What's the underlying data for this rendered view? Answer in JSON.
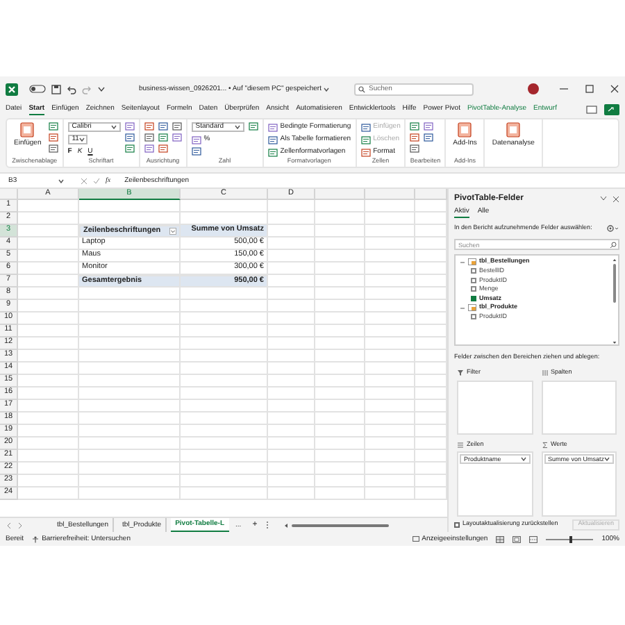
{
  "title_bar": {
    "title": "business-wissen_0926201... • Auf \"diesem PC\" gespeichert",
    "search": {
      "placeholder": "Suchen"
    }
  },
  "menu_tabs": [
    {
      "label": "Datei",
      "selected": false,
      "contextual": false
    },
    {
      "label": "Start",
      "selected": true,
      "contextual": false
    },
    {
      "label": "Einfügen",
      "selected": false,
      "contextual": false
    },
    {
      "label": "Zeichnen",
      "selected": false,
      "contextual": false
    },
    {
      "label": "Seitenlayout",
      "selected": false,
      "contextual": false
    },
    {
      "label": "Formeln",
      "selected": false,
      "contextual": false
    },
    {
      "label": "Daten",
      "selected": false,
      "contextual": false
    },
    {
      "label": "Überprüfen",
      "selected": false,
      "contextual": false
    },
    {
      "label": "Ansicht",
      "selected": false,
      "contextual": false
    },
    {
      "label": "Automatisieren",
      "selected": false,
      "contextual": false
    },
    {
      "label": "Entwicklertools",
      "selected": false,
      "contextual": false
    },
    {
      "label": "Hilfe",
      "selected": false,
      "contextual": false
    },
    {
      "label": "Power Pivot",
      "selected": false,
      "contextual": false
    },
    {
      "label": "PivotTable-Analyse",
      "selected": false,
      "contextual": true
    },
    {
      "label": "Entwurf",
      "selected": false,
      "contextual": true
    }
  ],
  "ribbon": [
    {
      "label": "Zwischenablage",
      "items": [
        {
          "kind": "large",
          "label": "Einfügen"
        },
        {
          "kind": "icon"
        },
        {
          "kind": "icon"
        },
        {
          "kind": "icon"
        }
      ]
    },
    {
      "label": "Schriftart",
      "items": [
        {
          "kind": "dropdown",
          "value": "Calibri",
          "wide": true
        },
        {
          "kind": "dropdown",
          "value": "11",
          "wide": false
        },
        {
          "kind": "letters",
          "labels": [
            "F",
            "K",
            "U"
          ]
        },
        {
          "kind": "icon"
        },
        {
          "kind": "icon"
        },
        {
          "kind": "icon"
        }
      ]
    },
    {
      "label": "Ausrichtung",
      "items": [
        {
          "kind": "icon"
        },
        {
          "kind": "icon"
        },
        {
          "kind": "icon"
        },
        {
          "kind": "icon"
        },
        {
          "kind": "icon"
        },
        {
          "kind": "icon"
        },
        {
          "kind": "icon"
        },
        {
          "kind": "icon"
        }
      ]
    },
    {
      "label": "Zahl",
      "items": [
        {
          "kind": "dropdown",
          "value": "Standard",
          "wide": true
        },
        {
          "kind": "small",
          "label": "%",
          "disabled": false
        },
        {
          "kind": "icon"
        },
        {
          "kind": "icon"
        }
      ]
    },
    {
      "label": "Formatvorlagen",
      "items": [
        {
          "kind": "small",
          "label": "Bedingte Formatierung",
          "disabled": false
        },
        {
          "kind": "small",
          "label": "Als Tabelle formatieren",
          "disabled": false
        },
        {
          "kind": "small",
          "label": "Zellenformatvorlagen",
          "disabled": false
        }
      ]
    },
    {
      "label": "Zellen",
      "items": [
        {
          "kind": "small",
          "label": "Einfügen",
          "disabled": true
        },
        {
          "kind": "small",
          "label": "Löschen",
          "disabled": true
        },
        {
          "kind": "small",
          "label": "Format",
          "disabled": false
        }
      ]
    },
    {
      "label": "Bearbeiten",
      "items": [
        {
          "kind": "icon"
        },
        {
          "kind": "icon"
        },
        {
          "kind": "icon"
        },
        {
          "kind": "icon"
        },
        {
          "kind": "icon"
        }
      ]
    },
    {
      "label": "Add-Ins",
      "items": [
        {
          "kind": "large",
          "label": "Add-Ins"
        }
      ]
    },
    {
      "items": [
        {
          "kind": "large",
          "label": "Datenanalyse"
        }
      ]
    }
  ],
  "formula_bar": {
    "name_box": "B3",
    "function_label": "fx",
    "formula": "Zeilenbeschriftungen"
  },
  "sheet": {
    "columns": [
      {
        "label": "A",
        "selected": false
      },
      {
        "label": "B",
        "selected": true
      },
      {
        "label": "C",
        "selected": false
      },
      {
        "label": "D",
        "selected": false
      }
    ],
    "rows": [
      {
        "label": "1",
        "selected": false
      },
      {
        "label": "2",
        "selected": false
      },
      {
        "label": "3",
        "selected": true
      },
      {
        "label": "4",
        "selected": false
      },
      {
        "label": "5",
        "selected": false
      },
      {
        "label": "6",
        "selected": false
      },
      {
        "label": "7",
        "selected": false
      },
      {
        "label": "8",
        "selected": false
      },
      {
        "label": "9",
        "selected": false
      },
      {
        "label": "10",
        "selected": false
      },
      {
        "label": "11",
        "selected": false
      },
      {
        "label": "12",
        "selected": false
      },
      {
        "label": "13",
        "selected": false
      },
      {
        "label": "14",
        "selected": false
      },
      {
        "label": "15",
        "selected": false
      },
      {
        "label": "16",
        "selected": false
      },
      {
        "label": "17",
        "selected": false
      },
      {
        "label": "18",
        "selected": false
      },
      {
        "label": "19",
        "selected": false
      },
      {
        "label": "20",
        "selected": false
      },
      {
        "label": "21",
        "selected": false
      },
      {
        "label": "22",
        "selected": false
      },
      {
        "label": "23",
        "selected": false
      },
      {
        "label": "24",
        "selected": false
      }
    ],
    "pivot": {
      "header": [
        "Zeilenbeschriftungen",
        "Summe von Umsatz"
      ],
      "rows": [
        {
          "label": "Laptop",
          "value": "500,00 €"
        },
        {
          "label": "Maus",
          "value": "150,00 €"
        },
        {
          "label": "Monitor",
          "value": "300,00 €"
        }
      ],
      "total": {
        "label": "Gesamtergebnis",
        "value": "950,00 €"
      }
    }
  },
  "sheet_tabs": [
    {
      "label": "tbl_Bestellungen",
      "selected": false
    },
    {
      "label": "tbl_Produkte",
      "selected": false
    },
    {
      "label": "Pivot-Tabelle-L",
      "selected": true
    }
  ],
  "sheet_tab_more": "...",
  "sheet_tab_add": "+",
  "pivot_pane": {
    "title": "PivotTable-Felder",
    "tabs": [
      {
        "label": "Aktiv",
        "selected": true
      },
      {
        "label": "Alle",
        "selected": false
      }
    ],
    "choose_label": "In den Bericht aufzunehmende Felder auswählen:",
    "search": {
      "placeholder": "Suchen"
    },
    "tables": [
      {
        "label": "tbl_Bestellungen",
        "expanded": true,
        "children": [
          {
            "label": "BestellID",
            "checked": false
          },
          {
            "label": "ProduktID",
            "checked": false
          },
          {
            "label": "Menge",
            "checked": false
          },
          {
            "label": "Umsatz",
            "checked": true
          }
        ]
      },
      {
        "label": "tbl_Produkte",
        "expanded": true,
        "children": [
          {
            "label": "ProduktID",
            "checked": false
          }
        ]
      }
    ],
    "drag_label": "Felder zwischen den Bereichen ziehen und ablegen:",
    "areas": [
      {
        "kind": "filter",
        "label": "Filter"
      },
      {
        "kind": "columns",
        "label": "Spalten"
      },
      {
        "kind": "rows",
        "label": "Zeilen",
        "fields": [
          "Produktname"
        ]
      },
      {
        "kind": "values",
        "label": "Werte",
        "fields": [
          "Summe von Umsatz"
        ]
      }
    ],
    "defer": {
      "label": "Layoutaktualisierung zurückstellen",
      "checked": false
    },
    "update_button": {
      "label": "Aktualisieren",
      "disabled": true
    }
  },
  "status_bar": {
    "status": "Bereit",
    "accessibility": "Barrierefreiheit: Untersuchen",
    "display_settings": "Anzeigeeinstellungen",
    "zoom": {
      "level": 0.5,
      "reading": "100%"
    }
  }
}
